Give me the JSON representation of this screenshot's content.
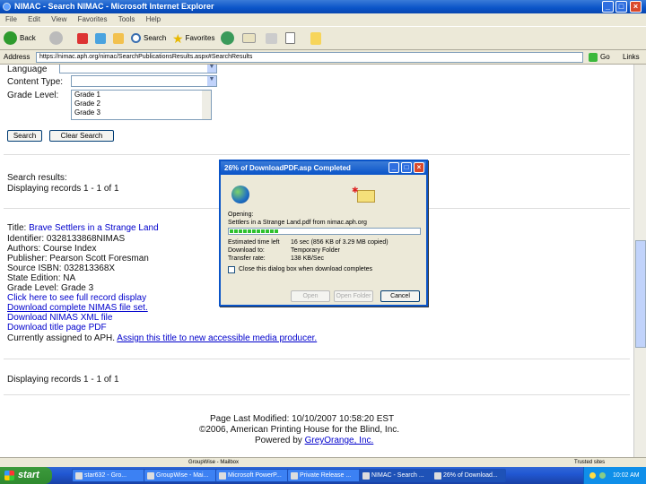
{
  "window": {
    "title": "NIMAC - Search NIMAC - Microsoft Internet Explorer",
    "minimize": "_",
    "maximize": "□",
    "close": "×"
  },
  "menu": [
    "File",
    "Edit",
    "View",
    "Favorites",
    "Tools",
    "Help"
  ],
  "toolbar": {
    "back_label": "Back",
    "search_label": "Search",
    "favorites_label": "Favorites"
  },
  "address": {
    "label": "Address",
    "url": "https://nimac.aph.org/nimac/SearchPublicationsResults.aspx#SearchResults",
    "go_label": "Go",
    "links_label": "Links"
  },
  "form": {
    "language_label": "Language",
    "content_type_label": "Content Type:",
    "grade_level_label": "Grade Level:",
    "grade_options": [
      "Grade 1",
      "Grade 2",
      "Grade 3"
    ],
    "search_button": "Search",
    "clear_button": "Clear Search"
  },
  "results": {
    "heading": "Search results:",
    "displaying": "Displaying records 1 - 1 of 1",
    "title_label": "Title:",
    "title_value": "Brave Settlers in a Strange Land",
    "identifier": "Identifier: 0328133868NIMAS",
    "authors": "Authors: Course Index",
    "publisher": "Publisher: Pearson Scott Foresman",
    "source_isbn": "Source ISBN: 032813368X",
    "state_edition": "State Edition: NA",
    "grade_level": "Grade Level: Grade 3",
    "link_display": "Click here to see full record display",
    "link_complete": "Download complete NIMAS file set.",
    "link_xml": "Download NIMAS XML file",
    "link_pdf": "Download title page PDF",
    "assigned_prefix": "Currently assigned to APH.",
    "assigned_link": "Assign this title to new accessible media producer.",
    "displaying_bottom": "Displaying records 1 - 1 of 1"
  },
  "footer": {
    "modified": "Page Last Modified: 10/10/2007 10:58:20 EST",
    "copyright": "©2006, American Printing House for the Blind, Inc.",
    "powered": "Powered by",
    "powered_link": "GreyOrange, Inc."
  },
  "dialog": {
    "title": "26% of DownloadPDF.asp Completed",
    "min": "_",
    "max": "□",
    "close": "×",
    "opening_label": "Opening:",
    "filename": "Settlers in a Strange Land.pdf from nimac.aph.org",
    "progress_fraction": 0.26,
    "time_left_label": "Estimated time left",
    "time_left_value": "16 sec (856 KB of 3.29 MB copied)",
    "download_to_label": "Download to:",
    "download_to_value": "Temporary Folder",
    "transfer_rate_label": "Transfer rate:",
    "transfer_rate_value": "138 KB/Sec",
    "checkbox_label": "Close this dialog box when download completes",
    "open_button": "Open",
    "open_folder_button": "Open Folder",
    "cancel_button": "Cancel"
  },
  "statusbar": {
    "text": "GroupWise - Mailbox",
    "zone": "Trusted sites"
  },
  "taskbar": {
    "start_label": "start",
    "tasks": [
      "star632 - Gro...",
      "GroupWise - Mai...",
      "Microsoft PowerP...",
      "Private Release ...",
      "NIMAC - Search ...",
      "26% of Download..."
    ],
    "clock": "10:02 AM"
  },
  "colors": {
    "title_blue": "#0a54c8",
    "link_blue": "#0000cc",
    "progress_green": "#2ec12e"
  }
}
